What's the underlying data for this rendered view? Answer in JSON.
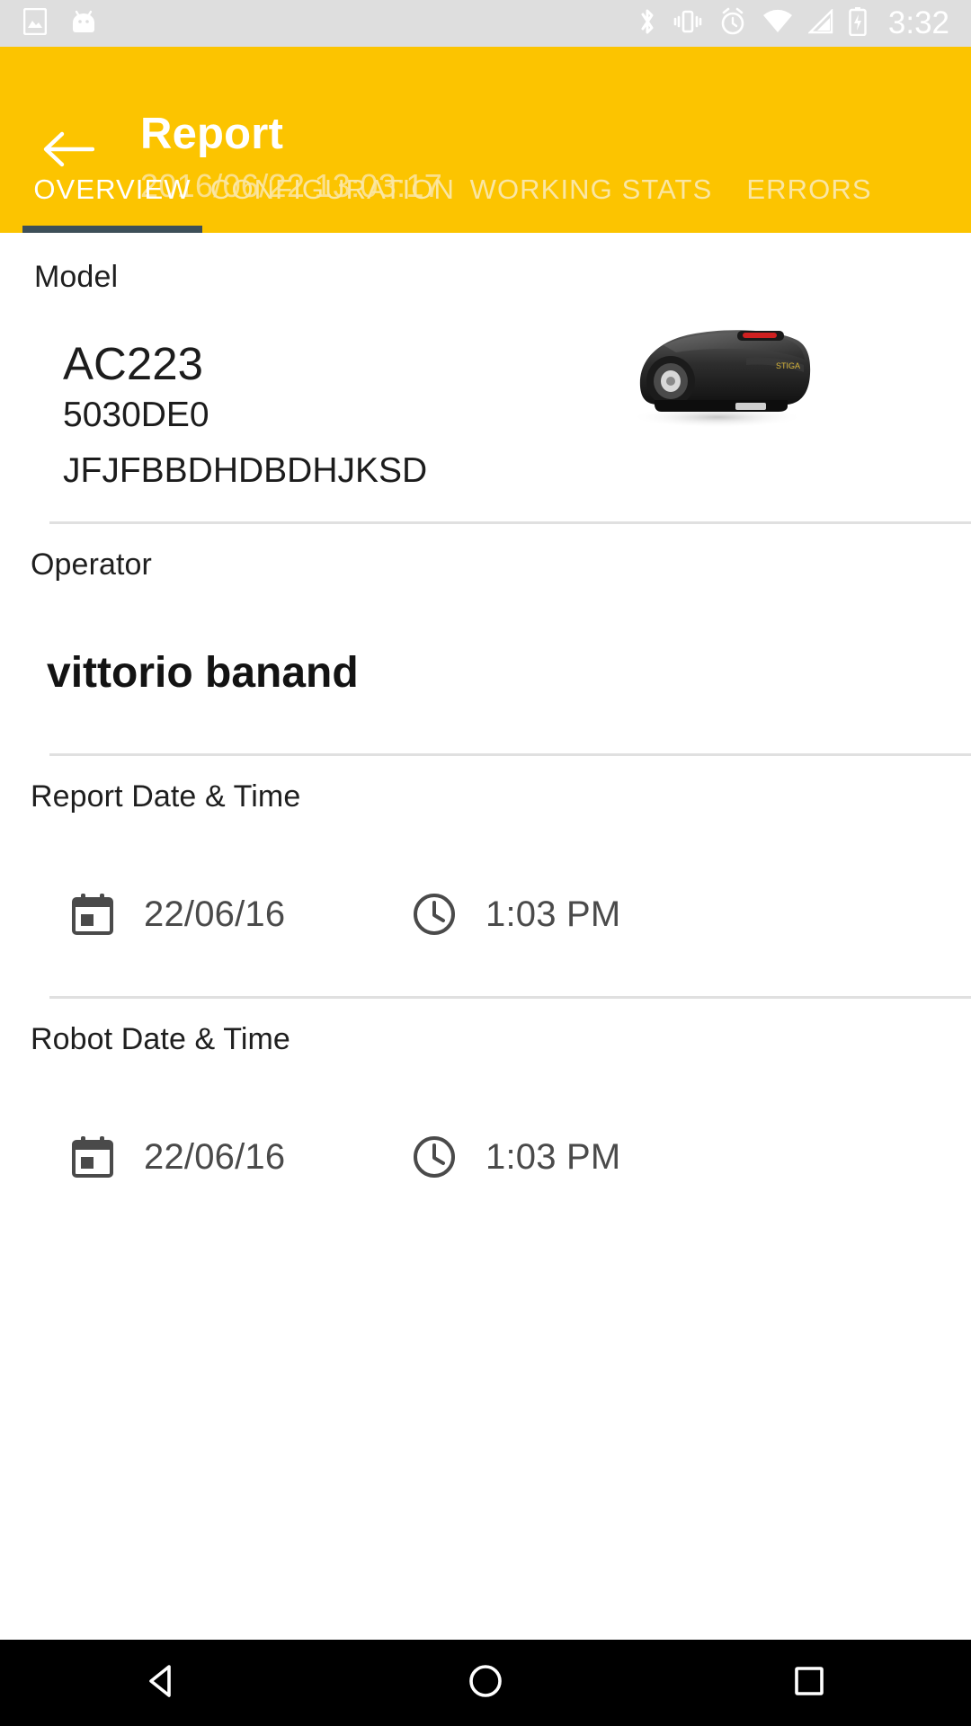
{
  "statusbar": {
    "time": "3:32",
    "left_icons": [
      "image-icon",
      "android-head-icon"
    ],
    "right_icons": [
      "bluetooth-icon",
      "vibrate-icon",
      "alarm-icon",
      "wifi-icon",
      "cellular-signal-icon",
      "battery-charging-icon"
    ]
  },
  "appbar": {
    "back_icon": "back-arrow-icon",
    "title": "Report",
    "subtitle": "2016/06/22 13:03:17",
    "background": "#fcc400",
    "title_color": "#ffffff",
    "subtitle_color": "#fbe08b"
  },
  "tabs": {
    "active_index": 0,
    "indicator_color": "#3d4f58",
    "items": [
      {
        "label": "OVERVIEW"
      },
      {
        "label": "CONFIGURATION"
      },
      {
        "label": "WORKING STATS"
      },
      {
        "label": "ERRORS"
      }
    ]
  },
  "sections": {
    "model": {
      "label": "Model",
      "value": "AC223",
      "code": "5030DE0",
      "serial": "JFJFBBDHDBDHJKSD",
      "image": "robot-lawnmower-image"
    },
    "operator": {
      "label": "Operator",
      "value": "vittorio banand"
    },
    "report_datetime": {
      "label": "Report Date & Time",
      "date_icon": "calendar-icon",
      "date": "22/06/16",
      "time_icon": "clock-icon",
      "time": "1:03 PM"
    },
    "robot_datetime": {
      "label": "Robot Date & Time",
      "date_icon": "calendar-icon",
      "date": "22/06/16",
      "time_icon": "clock-icon",
      "time": "1:03 PM"
    }
  },
  "navbar": {
    "back": "nav-back-icon",
    "home": "nav-home-icon",
    "recents": "nav-recents-icon"
  }
}
